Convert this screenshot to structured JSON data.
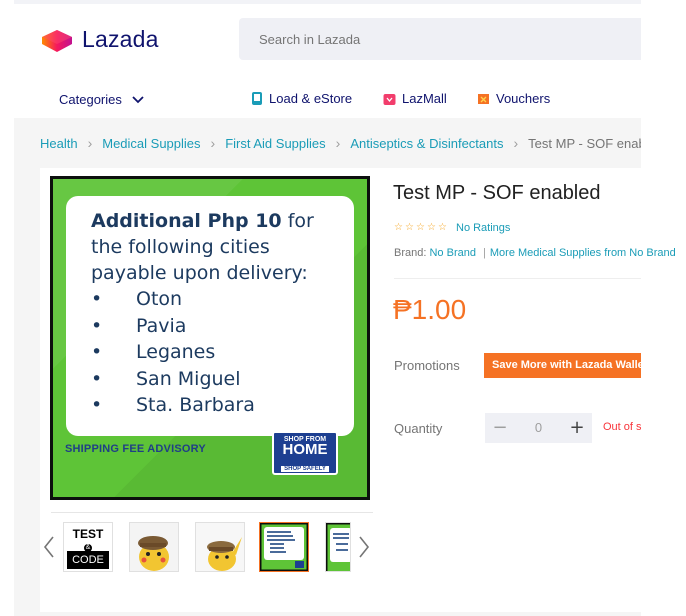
{
  "header": {
    "logo_text": "Lazada",
    "search_placeholder": "Search in Lazada"
  },
  "nav": {
    "categories_label": "Categories",
    "links": [
      {
        "label": "Load & eStore",
        "icon": "phone-icon",
        "color": "#1a9cb7"
      },
      {
        "label": "LazMall",
        "icon": "lazmall-icon",
        "color": "#f23d6c"
      },
      {
        "label": "Vouchers",
        "icon": "voucher-icon",
        "color": "#f57224"
      }
    ]
  },
  "breadcrumb": {
    "items": [
      "Health",
      "Medical Supplies",
      "First Aid Supplies",
      "Antiseptics & Disinfectants"
    ],
    "current": "Test MP - SOF enabled"
  },
  "product_image": {
    "note_bold": "Additional Php 10",
    "note_rest": " for",
    "note_line2": "the following cities",
    "note_line3": "payable upon delivery:",
    "bullet": "•",
    "cities": [
      "Oton",
      "Pavia",
      "Leganes",
      "San Miguel",
      "Sta. Barbara"
    ],
    "advisory": "SHIPPING FEE ADVISORY",
    "badge_top": "SHOP FROM",
    "badge_main": "HOME",
    "badge_bottom": "SHOP SAFELY"
  },
  "thumbnails": {
    "test_top": "TEST",
    "test_amp": "&",
    "test_bottom": "CODE",
    "active_index": 3
  },
  "product": {
    "title": "Test MP - SOF enabled",
    "rating": 0,
    "ratings_text": "No Ratings",
    "brand_label": "Brand:",
    "brand_value": "No Brand",
    "more_link": "More Medical Supplies from No Brand",
    "price": "₱1.00",
    "promotions_label": "Promotions",
    "promo_button": "Save More with Lazada Wallet",
    "quantity_label": "Quantity",
    "quantity_value": "0",
    "minus": "−",
    "plus": "+",
    "stock_status": "Out of stock"
  },
  "colors": {
    "brand_navy": "#0f136d",
    "accent_orange": "#f57224",
    "link_teal": "#1a9cb7",
    "image_green": "#5ec437"
  }
}
